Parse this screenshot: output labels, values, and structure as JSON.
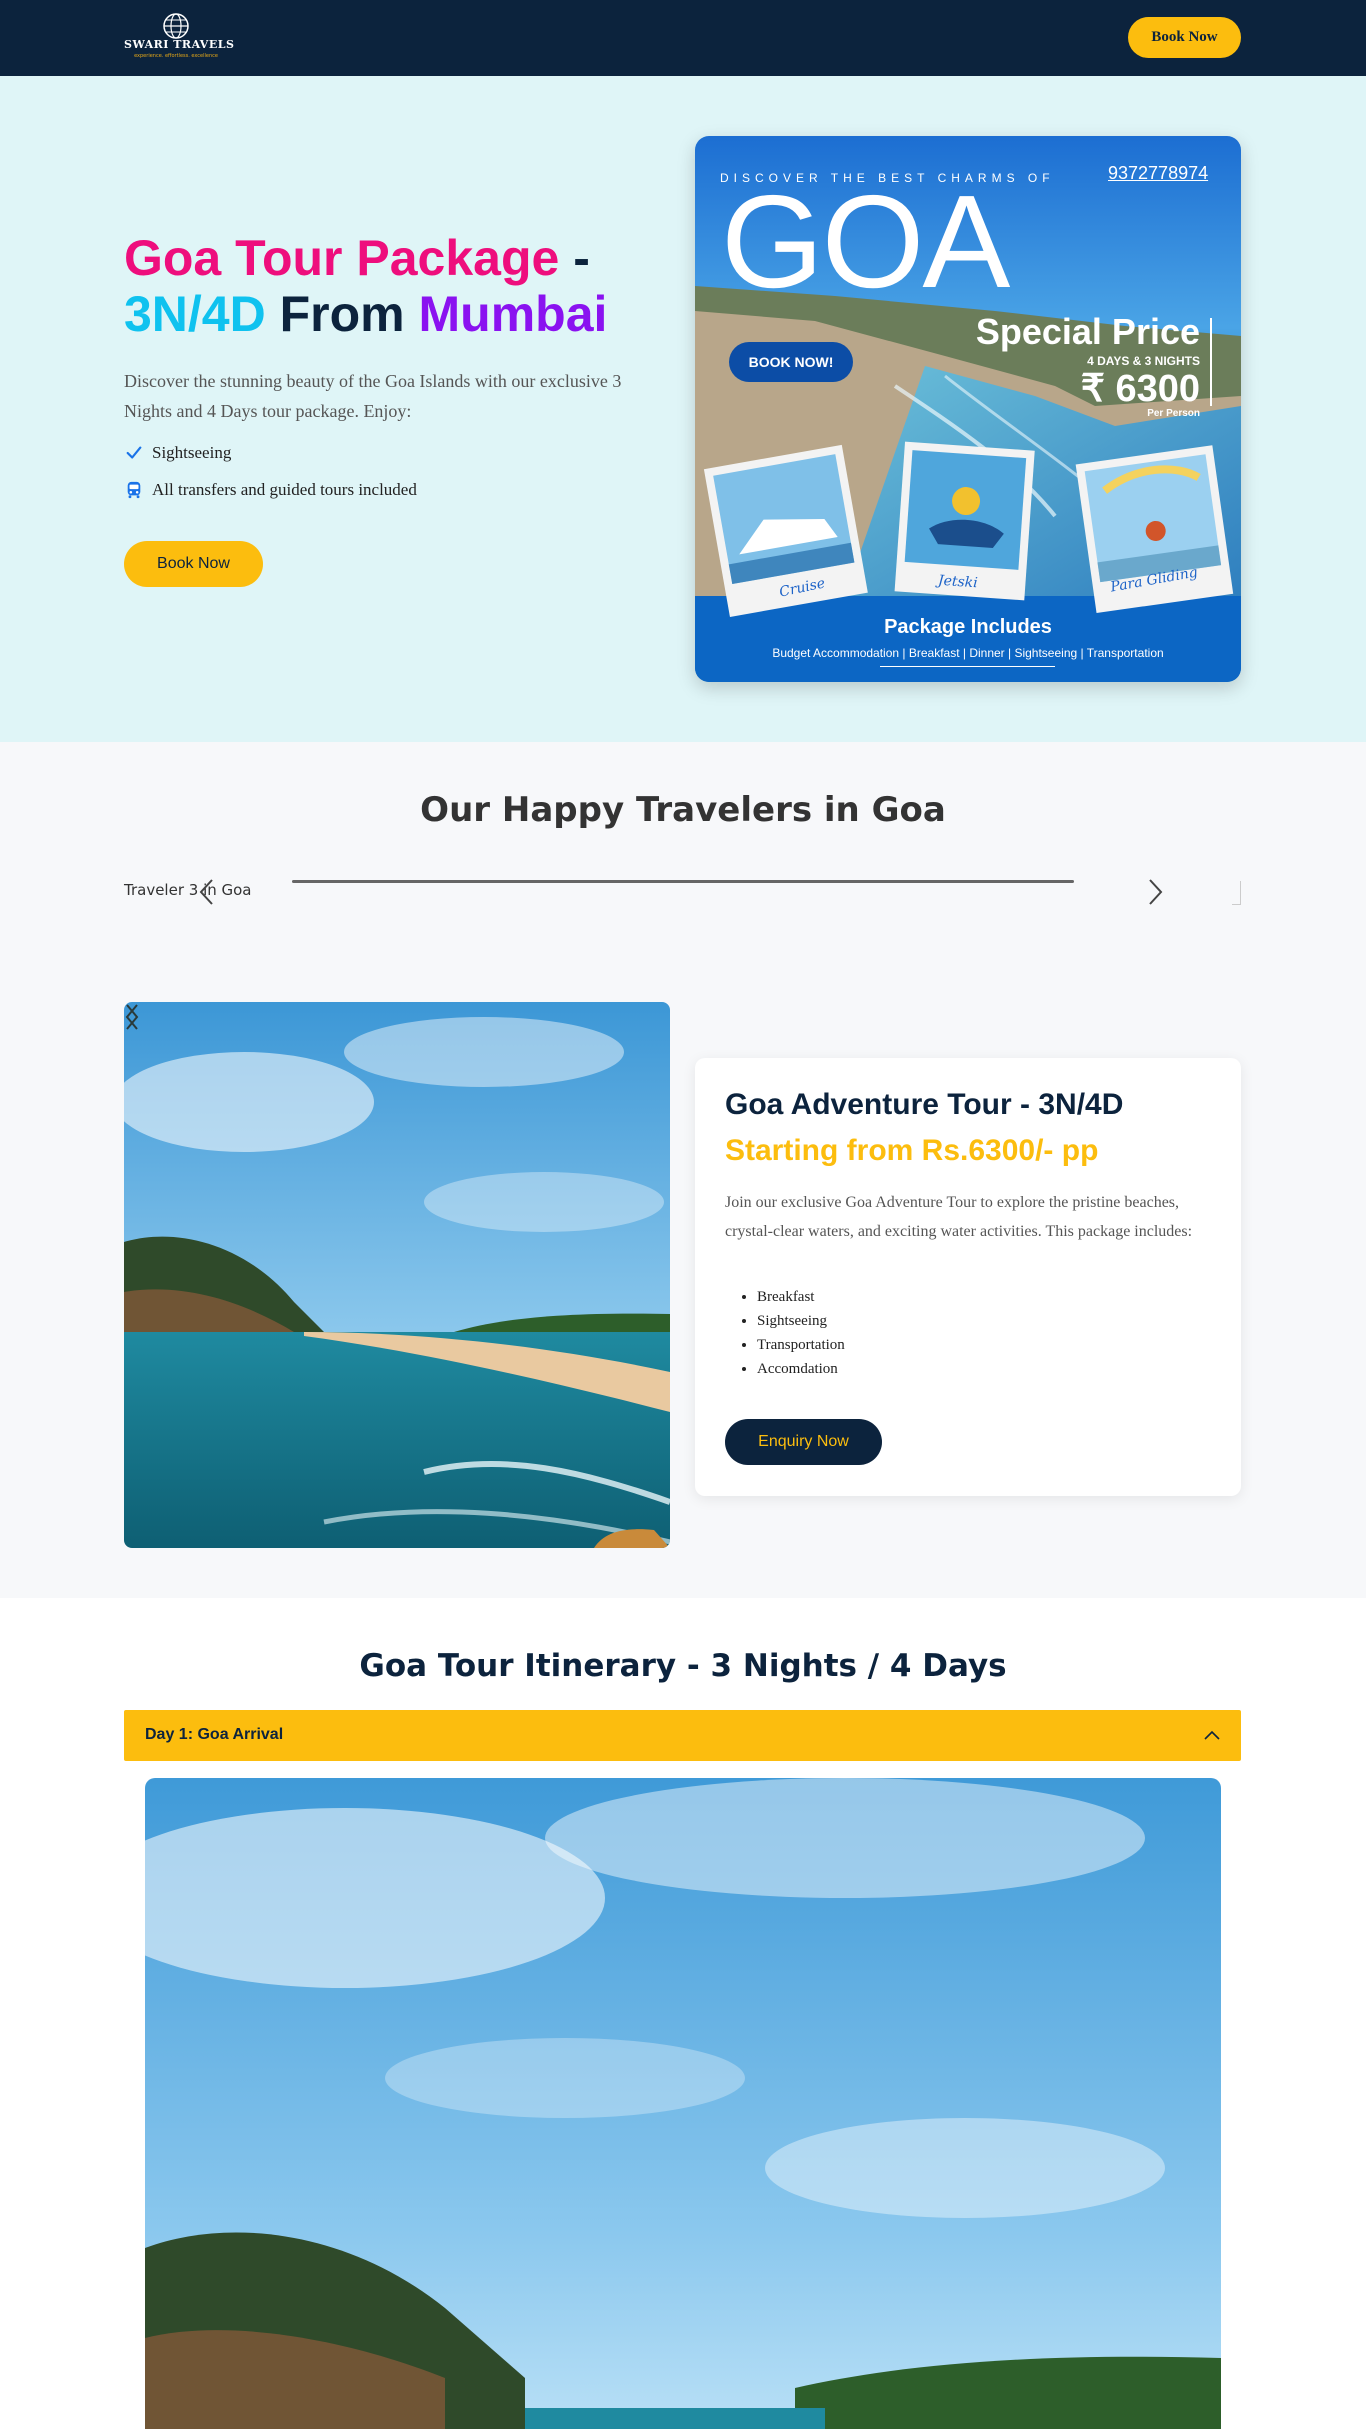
{
  "header": {
    "logo_title": "SWARI TRAVELS",
    "logo_tagline": "experience. effortless. excellence",
    "book_now": "Book Now"
  },
  "hero": {
    "title_part1": "Goa Tour Package",
    "title_dash": " -",
    "title_part2": "3N/4D",
    "title_from": " From ",
    "title_part3": "Mumbai",
    "description": "Discover the stunning beauty of the Goa Islands with our exclusive 3 Nights and 4 Days tour package. Enjoy:",
    "features": [
      {
        "icon": "check-icon",
        "label": "Sightseeing"
      },
      {
        "icon": "bus-icon",
        "label": "All transfers and guided tours included"
      }
    ],
    "book_now": "Book Now",
    "poster": {
      "discover": "DISCOVER THE BEST CHARMS OF",
      "phone": "9372778974",
      "goa": "GOA",
      "book_now": "BOOK NOW!",
      "special_price": "Special Price",
      "days": "4 DAYS & 3 NIGHTS",
      "price": "₹ 6300",
      "per_person": "Per Person",
      "captions": [
        "Cruise",
        "Jetski",
        "Para Gliding"
      ],
      "includes_title": "Package Includes",
      "includes_list": "Budget Accommodation | Breakfast | Dinner | Sightseeing | Transportation"
    }
  },
  "travelers": {
    "title": "Our Happy Travelers in Goa",
    "broken_image_alt": "Traveler 3 in Goa"
  },
  "tour_card": {
    "title": "Goa Adventure Tour - 3N/4D",
    "subtitle": "Starting from Rs.6300/- pp",
    "description": "Join our exclusive Goa Adventure Tour to explore the pristine beaches, crystal-clear waters, and exciting water activities. This package includes:",
    "items": [
      "Breakfast",
      "Sightseeing",
      "Transportation",
      "Accomdation"
    ],
    "button": "Enquiry Now"
  },
  "itinerary": {
    "title": "Goa Tour Itinerary - 3 Nights / 4 Days",
    "day1": "Day 1: Goa Arrival"
  },
  "colors": {
    "navy": "#0c233d",
    "yellow": "#fcbd0e",
    "hero_bg": "#dff5f7",
    "pink": "#ee0e7d",
    "cyan": "#0fc2ef",
    "purple": "#8a12f0"
  }
}
